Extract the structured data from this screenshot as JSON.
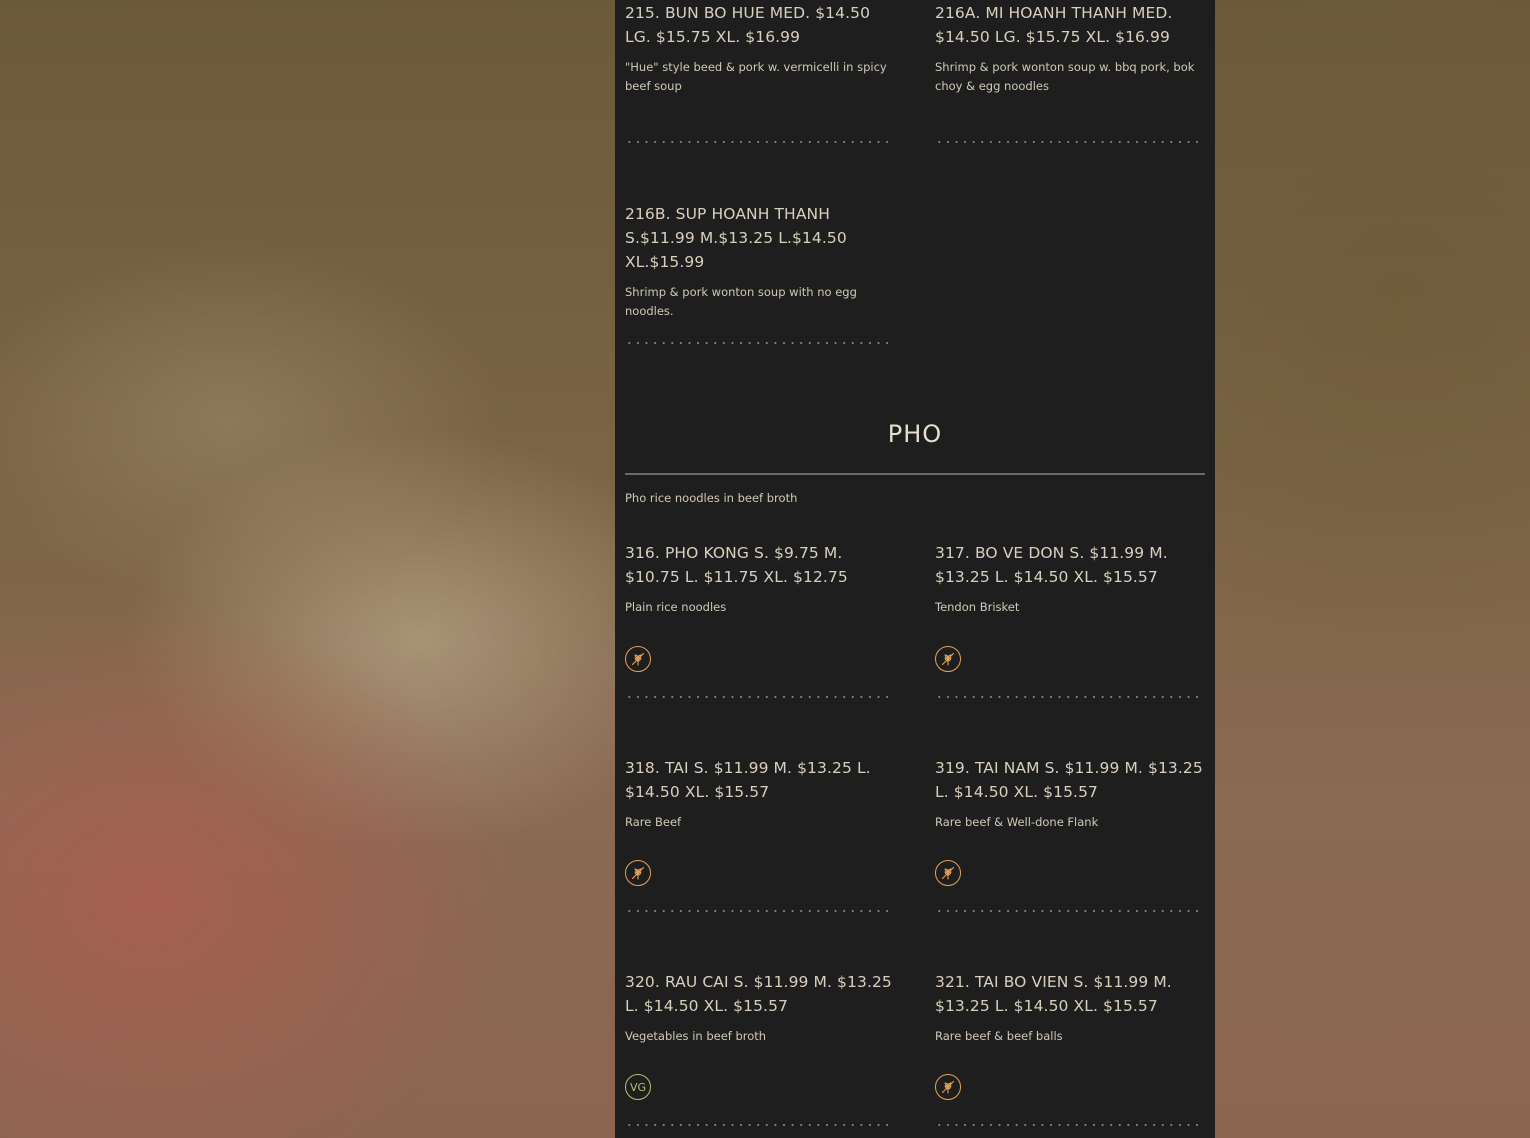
{
  "colors": {
    "panel_bg": "#1e1e1e",
    "text": "#d9cfbd",
    "gluten_free_badge": "#e3a35a",
    "vegan_badge": "#b4c26a"
  },
  "previous_section": {
    "items": [
      {
        "title": "215. BUN BO HUE MED. $14.50 LG. $15.75 XL. $16.99",
        "desc": "\"Hue\" style beed & pork w. vermicelli in spicy beef soup"
      },
      {
        "title": "216A. MI HOANH THANH MED. $14.50 LG. $15.75 XL. $16.99",
        "desc": "Shrimp & pork wonton soup w. bbq pork, bok choy & egg noodles"
      },
      {
        "title": "216B. SUP HOANH THANH S.$11.99 M.$13.25 L.$14.50 XL.$15.99",
        "desc": "Shrimp & pork wonton soup with no egg noodles."
      }
    ]
  },
  "pho_section": {
    "title": "PHO",
    "description": "Pho rice noodles in beef broth",
    "items": [
      {
        "title": "316. PHO KONG S. $9.75 M. $10.75 L. $11.75 XL. $12.75",
        "desc": "Plain rice noodles",
        "badge": "gluten-free-icon"
      },
      {
        "title": "317. BO VE DON S. $11.99 M. $13.25 L. $14.50 XL. $15.57",
        "desc": "Tendon Brisket",
        "badge": "gluten-free-icon"
      },
      {
        "title": "318. TAI S. $11.99 M. $13.25 L. $14.50 XL. $15.57",
        "desc": "Rare Beef",
        "badge": "gluten-free-icon"
      },
      {
        "title": "319. TAI NAM S. $11.99 M. $13.25 L. $14.50 XL. $15.57",
        "desc": "Rare beef & Well-done Flank",
        "badge": "gluten-free-icon"
      },
      {
        "title": "320. RAU CAI S. $11.99 M. $13.25 L. $14.50 XL. $15.57",
        "desc": "Vegetables in beef broth",
        "badge": "vegan-icon",
        "badge_text": "VG"
      },
      {
        "title": "321. TAI BO VIEN S. $11.99 M. $13.25 L. $14.50 XL. $15.57",
        "desc": "Rare beef & beef balls",
        "badge": "gluten-free-icon"
      }
    ]
  }
}
